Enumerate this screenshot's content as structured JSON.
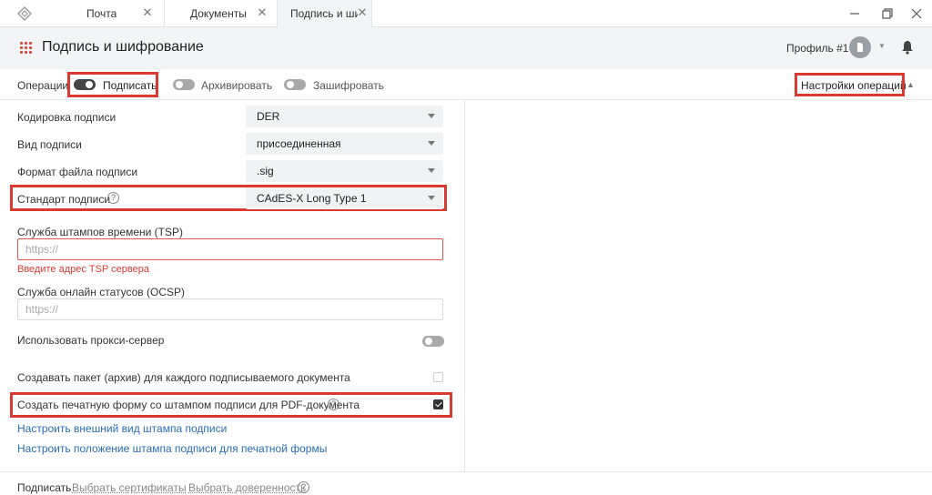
{
  "tabs": [
    {
      "label": "Почта",
      "active": false
    },
    {
      "label": "Документы",
      "active": false
    },
    {
      "label": "Подпись и шифро...",
      "active": true
    }
  ],
  "header": {
    "title": "Подпись и шифрование",
    "profile": "Профиль #1"
  },
  "operations": {
    "label": "Операции",
    "sign": "Подписать",
    "archive": "Архивировать",
    "encrypt": "Зашифровать",
    "settings": "Настройки операций"
  },
  "form": {
    "encoding": {
      "label": "Кодировка подписи",
      "value": "DER"
    },
    "type": {
      "label": "Вид подписи",
      "value": "присоединенная"
    },
    "format": {
      "label": "Формат файла подписи",
      "value": ".sig"
    },
    "standard": {
      "label": "Стандарт подписи",
      "value": "CAdES-X Long Type 1"
    },
    "tsp": {
      "label": "Служба штампов времени (TSP)",
      "placeholder": "https://",
      "error": "Введите адрес TSP сервера"
    },
    "ocsp": {
      "label": "Служба онлайн статусов (OCSP)",
      "placeholder": "https://"
    },
    "proxy": {
      "label": "Использовать прокси-сервер"
    },
    "package": {
      "label": "Создавать пакет (архив) для каждого подписываемого документа"
    },
    "print_form": {
      "label": "Создать печатную форму со штампом подписи для PDF-документа"
    },
    "stamp_appearance": "Настроить внешний вид штампа подписи",
    "stamp_position": "Настроить положение штампа подписи для печатной формы"
  },
  "footer": {
    "sign": "Подписать",
    "select_certs": "Выбрать сертификаты",
    "select_poa": "Выбрать доверенность"
  },
  "icons": {
    "help": "?",
    "close": "✕"
  },
  "colors": {
    "highlight": "#d93b30",
    "link": "#2a6cb8",
    "accent": "#d64b3c"
  }
}
